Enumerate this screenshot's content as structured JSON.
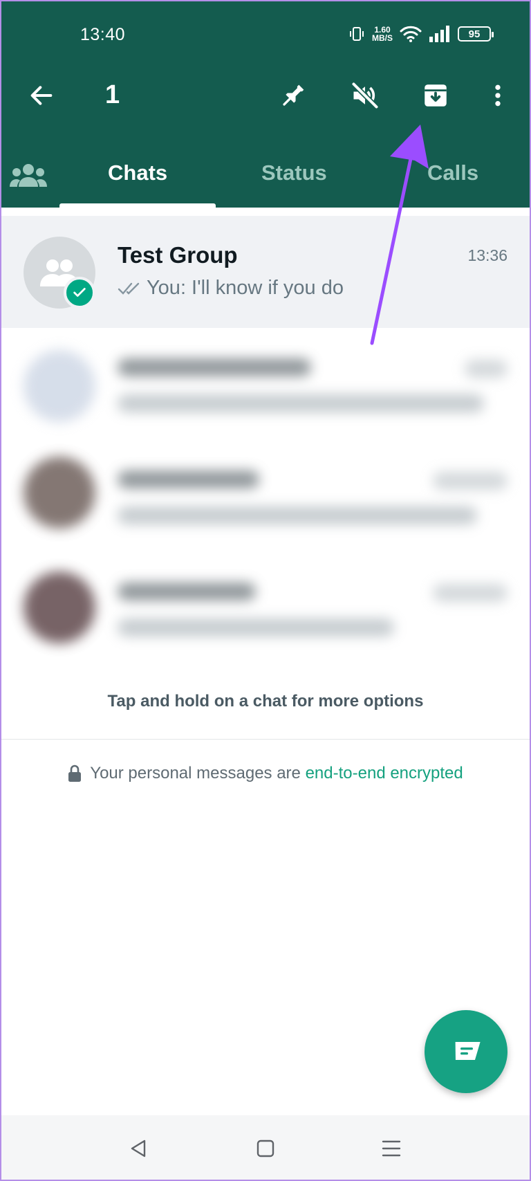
{
  "status_bar": {
    "time": "13:40",
    "net_speed_value": "1.60",
    "net_speed_unit": "MB/S",
    "battery": "95"
  },
  "action_bar": {
    "back_icon": "arrow-left-icon",
    "selected_count": "1",
    "actions": [
      "pin-icon",
      "mute-icon",
      "archive-icon",
      "more-vert-icon"
    ]
  },
  "tabs": {
    "community_icon": "community-icon",
    "items": [
      {
        "label": "Chats",
        "active": true
      },
      {
        "label": "Status",
        "active": false
      },
      {
        "label": "Calls",
        "active": false
      }
    ]
  },
  "chats": {
    "selected": {
      "name": "Test Group",
      "time": "13:36",
      "preview": "You: I'll know if you do",
      "read_icon": "double-check-icon"
    }
  },
  "hint": "Tap and hold on a chat for more options",
  "encryption": {
    "text": "Your personal messages are",
    "link": "end-to-end encrypted"
  },
  "fab_icon": "new-chat-icon",
  "colors": {
    "header": "#145c4f",
    "accent": "#00a884",
    "annotation_arrow": "#9b4dff"
  }
}
